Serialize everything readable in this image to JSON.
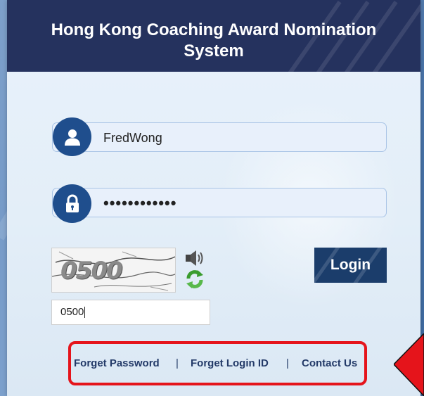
{
  "header": {
    "title_line1": "Hong Kong Coaching Award Nomination",
    "title_line2": "System"
  },
  "login_form": {
    "username": {
      "icon": "user-icon",
      "value": "FredWong"
    },
    "password": {
      "icon": "lock-icon",
      "masked_value": "••••••••••••"
    },
    "captcha": {
      "image_text": "0500",
      "audio_icon": "speaker-icon",
      "refresh_icon": "refresh-icon",
      "input_value": "0500"
    },
    "login_label": "Login"
  },
  "links": [
    {
      "label": "Forget Password"
    },
    {
      "label": "Forget Login ID"
    },
    {
      "label": "Contact Us"
    }
  ],
  "separator": "|",
  "colors": {
    "header_bg": "#25325e",
    "accent": "#1f4e8d",
    "highlight": "#e5141b"
  }
}
